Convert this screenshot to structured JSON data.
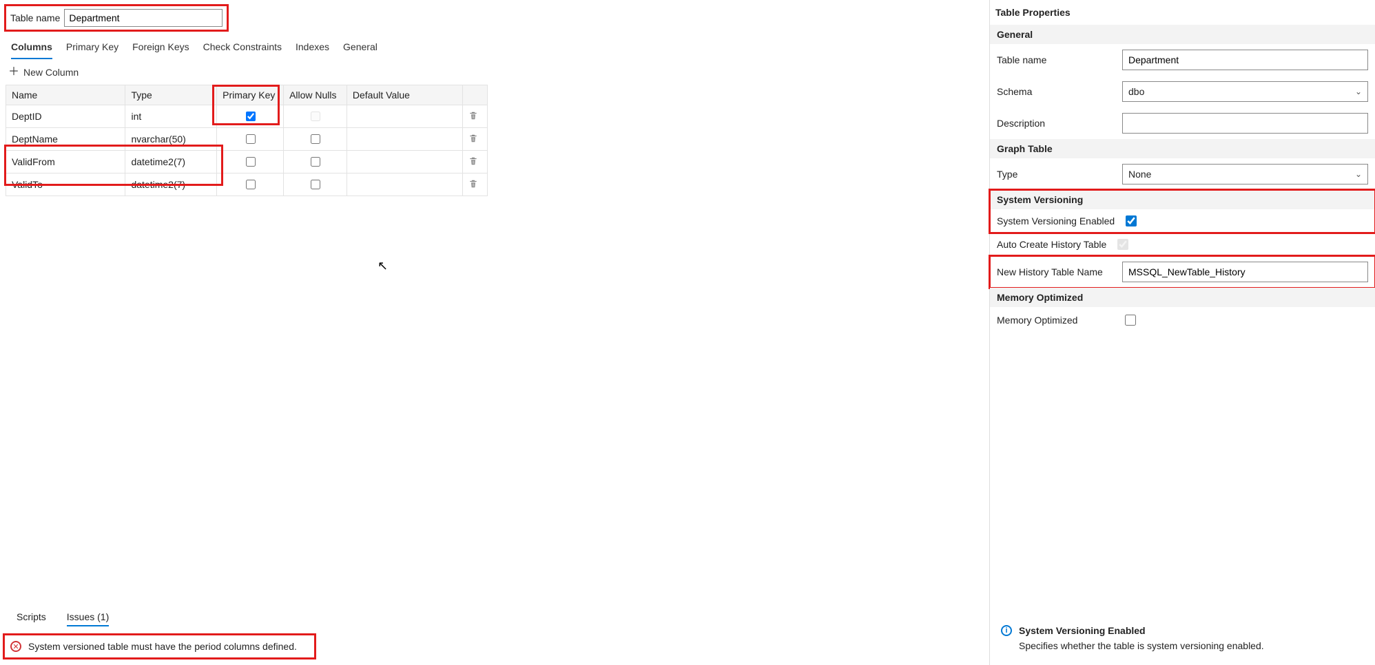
{
  "topbar": {
    "table_name_label": "Table name",
    "table_name_value": "Department"
  },
  "tabs": {
    "columns": "Columns",
    "primary_key": "Primary Key",
    "foreign_keys": "Foreign Keys",
    "check_constraints": "Check Constraints",
    "indexes": "Indexes",
    "general": "General"
  },
  "new_column_label": "New Column",
  "grid_headers": {
    "name": "Name",
    "type": "Type",
    "pk": "Primary Key",
    "nulls": "Allow Nulls",
    "default": "Default Value"
  },
  "columns": [
    {
      "name": "DeptID",
      "type": "int",
      "pk": true,
      "nulls": false,
      "nulls_disabled": true,
      "default": ""
    },
    {
      "name": "DeptName",
      "type": "nvarchar(50)",
      "pk": false,
      "nulls": false,
      "nulls_disabled": false,
      "default": ""
    },
    {
      "name": "ValidFrom",
      "type": "datetime2(7)",
      "pk": false,
      "nulls": false,
      "nulls_disabled": false,
      "default": ""
    },
    {
      "name": "ValidTo",
      "type": "datetime2(7)",
      "pk": false,
      "nulls": false,
      "nulls_disabled": false,
      "default": ""
    }
  ],
  "bottom_tabs": {
    "scripts": "Scripts",
    "issues": "Issues (1)"
  },
  "issue_text": "System versioned table must have the period columns defined.",
  "right": {
    "title": "Table Properties",
    "sections": {
      "general": "General",
      "graph": "Graph Table",
      "sysver": "System Versioning",
      "memopt": "Memory Optimized"
    },
    "labels": {
      "table_name": "Table name",
      "schema": "Schema",
      "description": "Description",
      "graph_type": "Type",
      "sysver_enabled": "System Versioning Enabled",
      "auto_history": "Auto Create History Table",
      "new_history": "New History Table Name",
      "memopt": "Memory Optimized"
    },
    "values": {
      "table_name": "Department",
      "schema": "dbo",
      "description": "",
      "graph_type": "None",
      "sysver_enabled": true,
      "auto_history": true,
      "auto_history_disabled": true,
      "new_history": "MSSQL_NewTable_History",
      "memopt": false
    },
    "help_title": "System Versioning Enabled",
    "help_text": "Specifies whether the table is system versioning enabled."
  }
}
